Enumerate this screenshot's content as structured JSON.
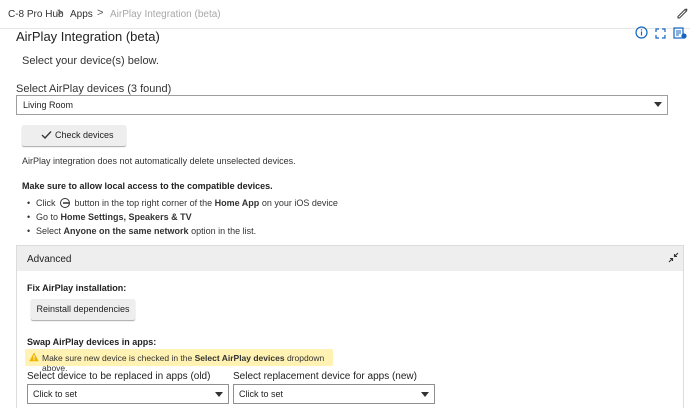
{
  "breadcrumb": {
    "hub": "C-8 Pro Hub",
    "apps": "Apps",
    "current": "AirPlay Integration (beta)",
    "separator": ">"
  },
  "header": {
    "title": "AirPlay Integration (beta)",
    "subtitle": "Select your device(s) below.",
    "icons": [
      "edit-icon",
      "info-icon",
      "expand-icon",
      "app-list-icon"
    ]
  },
  "device_select": {
    "label": "Select AirPlay devices (3 found)",
    "value": "Living Room"
  },
  "check_button": {
    "label": "Check devices",
    "icon": "check-icon"
  },
  "note": "AirPlay integration does not automatically delete unselected devices.",
  "allow_text": "Make sure to allow local access to the compatible devices.",
  "steps": {
    "s1_before": "Click",
    "s1_mid": "button in the top right corner of the",
    "s1_bold": "Home App",
    "s1_after": "on your iOS device",
    "s2_before": "Go to",
    "s2_bold": "Home Settings, Speakers & TV",
    "s3_before": "Select",
    "s3_bold": "Anyone on the same network",
    "s3_after": "option in the list."
  },
  "advanced": {
    "title": "Advanced",
    "fix_label": "Fix AirPlay installation:",
    "reinstall_label": "Reinstall dependencies",
    "swap_label": "Swap AirPlay devices in apps:",
    "warning": {
      "before": "Make sure new device is checked in the",
      "bold": "Select AirPlay devices",
      "after": "dropdown above."
    },
    "old_label": "Select device to be replaced in apps (old)",
    "new_label": "Select replacement device for apps (new)",
    "old_value": "Click to set",
    "new_value": "Click to set"
  },
  "colors": {
    "warning_bg": "#fff2b3",
    "warning_icon": "#f0b400",
    "accent_icon": "#1565c0",
    "button_bg": "#eeeeee"
  }
}
